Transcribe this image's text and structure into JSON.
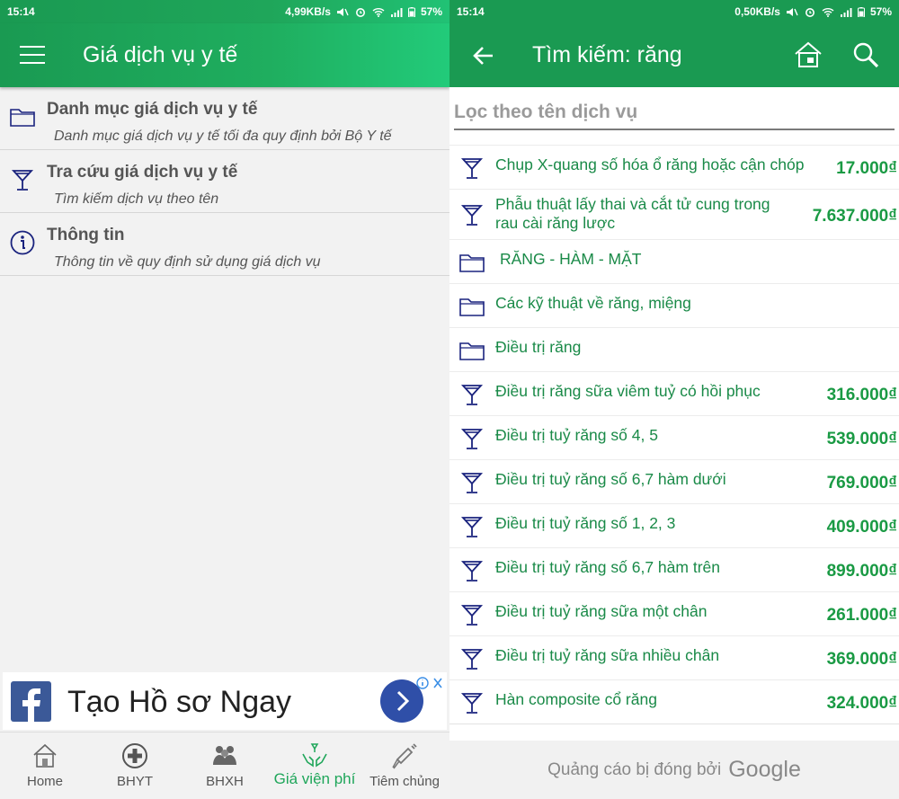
{
  "left": {
    "status": {
      "time": "15:14",
      "speed": "4,99KB/s",
      "battery": "57%"
    },
    "appbar": {
      "title": "Giá dịch vụ y tế"
    },
    "menu": [
      {
        "title": "Danh mục giá dịch vụ y tế",
        "subtitle": "Danh mục giá dịch vụ y tế tối đa quy định bởi Bộ Y tế",
        "icon": "folder-icon"
      },
      {
        "title": "Tra cứu giá dịch vụ y tế",
        "subtitle": "Tìm kiếm dịch vụ theo tên",
        "icon": "cocktail-icon"
      },
      {
        "title": "Thông tin",
        "subtitle": "Thông tin về quy định sử dụng giá dịch vụ",
        "icon": "info-icon"
      }
    ],
    "ad": {
      "text": "Tạo Hồ sơ Ngay"
    },
    "nav": [
      {
        "label": "Home",
        "icon": "home-icon",
        "active": false
      },
      {
        "label": "BHYT",
        "icon": "cross-icon",
        "active": false
      },
      {
        "label": "BHXH",
        "icon": "people-icon",
        "active": false
      },
      {
        "label": "Giá viện phí",
        "icon": "hands-icon",
        "active": true
      },
      {
        "label": "Tiêm chủng",
        "icon": "syringe-icon",
        "active": false
      }
    ]
  },
  "right": {
    "status": {
      "time": "15:14",
      "speed": "0,50KB/s",
      "battery": "57%"
    },
    "appbar": {
      "title": "Tìm kiếm: răng"
    },
    "filter": {
      "placeholder": "Lọc theo tên dịch vụ"
    },
    "results": [
      {
        "type": "service",
        "name": "Chụp X-quang số hóa ổ răng hoặc cận chóp",
        "price": "17.000₫"
      },
      {
        "type": "service",
        "name": "Phẫu thuật lấy thai và cắt tử cung trong rau cài răng lược",
        "price": "7.637.000₫"
      },
      {
        "type": "category",
        "name": "RĂNG - HÀM - MẶT",
        "price": ""
      },
      {
        "type": "category",
        "name": "Các kỹ thuật về răng, miệng",
        "price": ""
      },
      {
        "type": "category",
        "name": "Điều trị răng",
        "price": ""
      },
      {
        "type": "service",
        "name": "Điều trị răng sữa viêm tuỷ có hồi phục",
        "price": "316.000₫"
      },
      {
        "type": "service",
        "name": "Điều trị tuỷ răng số  4, 5",
        "price": "539.000₫"
      },
      {
        "type": "service",
        "name": "Điều trị tuỷ răng số  6,7 hàm dưới",
        "price": "769.000₫"
      },
      {
        "type": "service",
        "name": "Điều trị tuỷ răng số 1, 2, 3",
        "price": "409.000₫"
      },
      {
        "type": "service",
        "name": "Điều trị tuỷ răng số 6,7 hàm trên",
        "price": "899.000₫"
      },
      {
        "type": "service",
        "name": "Điều trị tuỷ răng sữa một chân",
        "price": "261.000₫"
      },
      {
        "type": "service",
        "name": "Điều trị tuỷ răng sữa nhiều chân",
        "price": "369.000₫"
      },
      {
        "type": "service",
        "name": "Hàn composite cổ răng",
        "price": "324.000₫"
      }
    ],
    "ad_closed": {
      "text": "Quảng cáo bị đóng bởi",
      "brand": "Google"
    }
  },
  "colors": {
    "primary": "#1a9a52",
    "accent": "#1fa65a",
    "icon": "#1a237e",
    "price": "#1a9a44"
  }
}
